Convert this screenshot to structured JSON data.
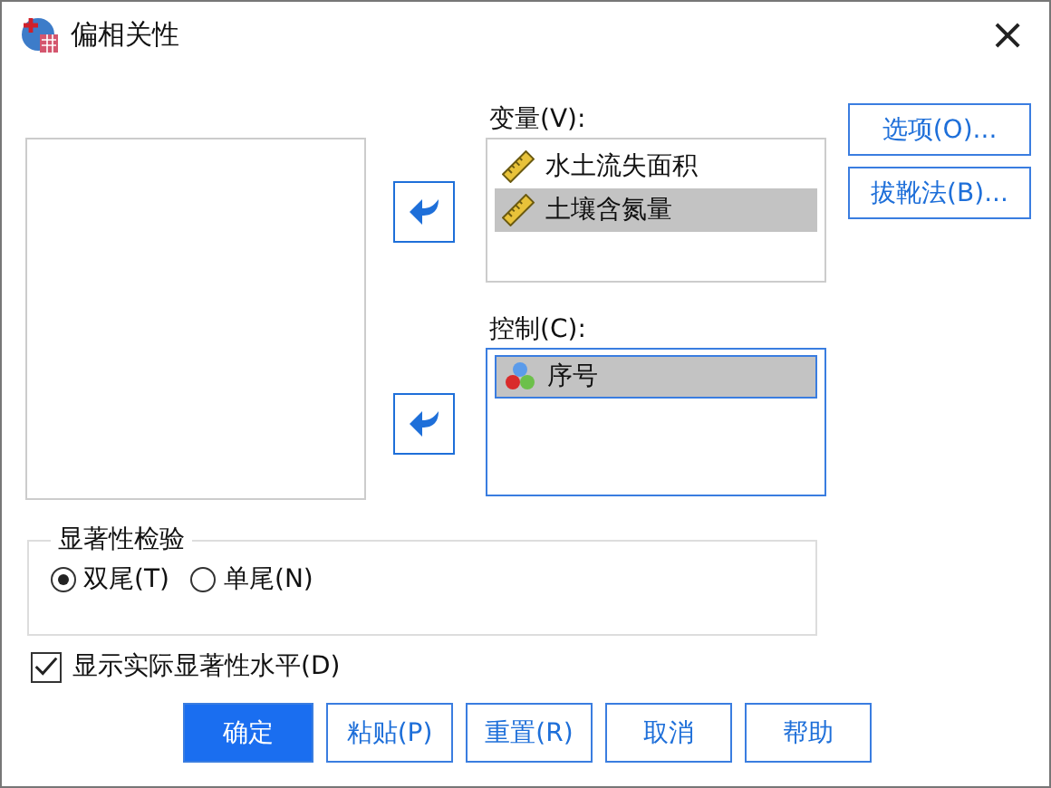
{
  "window": {
    "title": "偏相关性",
    "close": "×"
  },
  "variables": {
    "label": "变量(V):",
    "items": [
      {
        "name": "水土流失面积",
        "kind": "scale",
        "selected": false
      },
      {
        "name": "土壤含氮量",
        "kind": "scale",
        "selected": true
      }
    ]
  },
  "controls": {
    "label": "控制(C):",
    "items": [
      {
        "name": "序号",
        "kind": "nominal",
        "selected": true
      }
    ]
  },
  "side_buttons": [
    "选项(O)...",
    "拔靴法(B)..."
  ],
  "significance": {
    "title": "显著性检验",
    "options": [
      {
        "label": "双尾(T)",
        "selected": true
      },
      {
        "label": "单尾(N)",
        "selected": false
      }
    ]
  },
  "show_actual": {
    "label": "显示实际显著性水平(D)",
    "checked": true
  },
  "buttons": [
    {
      "label": "确定",
      "primary": true
    },
    {
      "label": "粘贴(P)",
      "primary": false
    },
    {
      "label": "重置(R)",
      "primary": false
    },
    {
      "label": "取消",
      "primary": false
    },
    {
      "label": "帮助",
      "primary": false
    }
  ]
}
